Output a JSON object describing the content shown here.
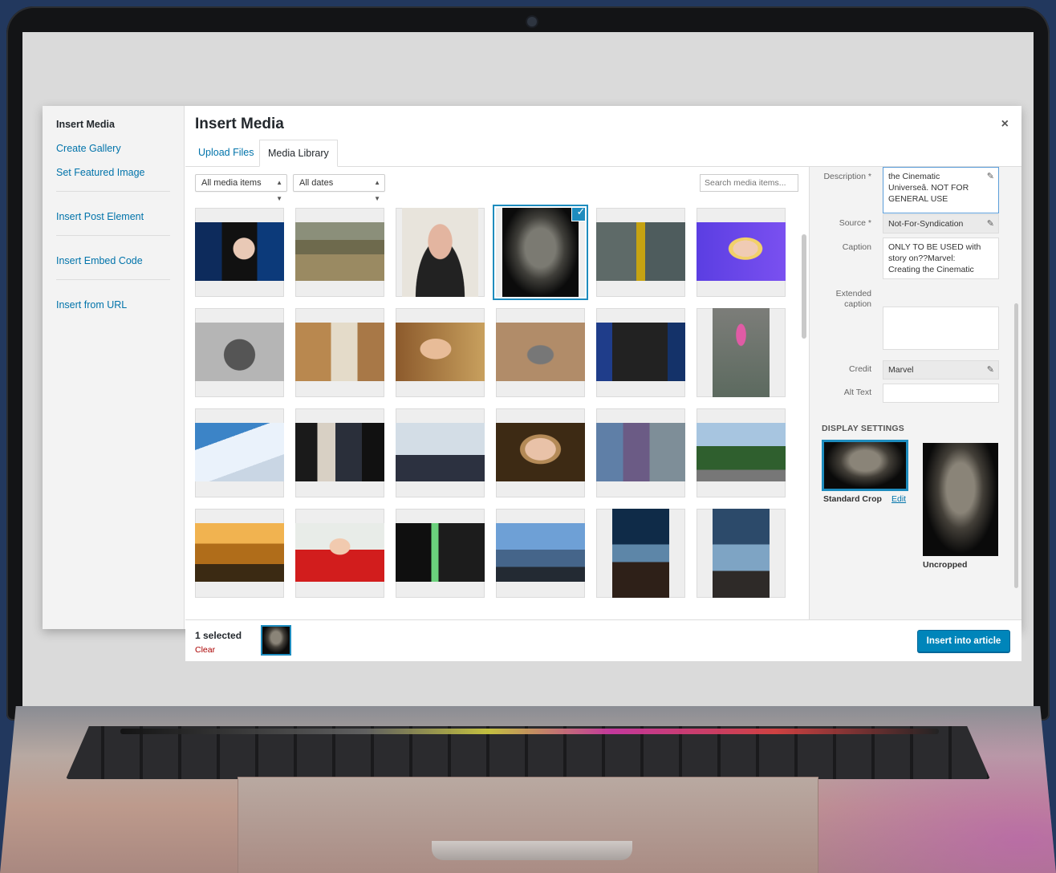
{
  "menu": {
    "title": "Insert Media",
    "items": [
      "Create Gallery",
      "Set Featured Image",
      "Insert Post Element",
      "Insert Embed Code",
      "Insert from URL"
    ]
  },
  "modal": {
    "title": "Insert Media",
    "close": "×",
    "tabs": [
      "Upload Files",
      "Media Library"
    ],
    "active_tab": "Media Library"
  },
  "toolbar": {
    "filter_type": "All media items",
    "filter_date": "All dates",
    "search_placeholder": "Search media items..."
  },
  "details": {
    "description_label": "Description *",
    "description_value": "the Cinematic Universeâ. NOT FOR GENERAL USE",
    "source_label": "Source *",
    "source_value": "Not-For-Syndication",
    "caption_label": "Caption",
    "caption_value": "ONLY TO BE USED with story on??Marvel: Creating the Cinematic",
    "extended_label": "Extended caption",
    "extended_value": "",
    "credit_label": "Credit",
    "credit_value": "Marvel",
    "alt_label": "Alt Text",
    "alt_value": ""
  },
  "display_settings": {
    "heading": "DISPLAY SETTINGS",
    "standard_label": "Standard Crop",
    "edit_label": "Edit",
    "uncropped_label": "Uncropped"
  },
  "footer": {
    "selected_count": "1 selected",
    "clear": "Clear",
    "insert_button": "Insert into article"
  },
  "icons": {
    "pencil": "pencil-icon",
    "check": "check-icon",
    "close": "close-icon"
  },
  "colors": {
    "accent": "#0085ba",
    "link": "#0073aa",
    "selection": "#1e8cbe",
    "clear": "#aa0000"
  }
}
